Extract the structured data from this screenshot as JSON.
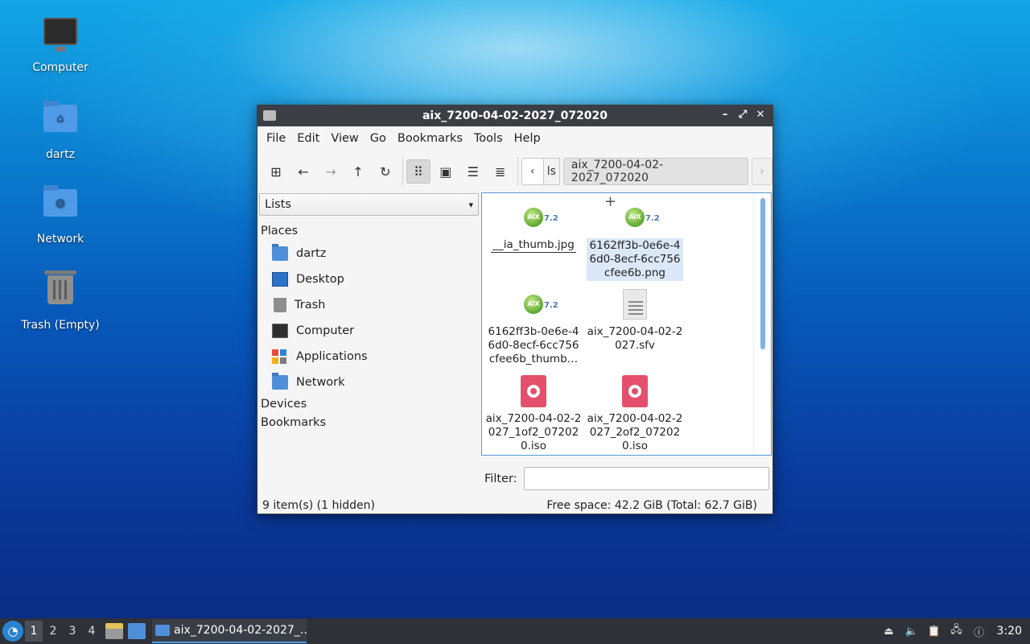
{
  "desktop": {
    "icons": [
      {
        "label": "Computer",
        "icon": "computer-icon"
      },
      {
        "label": "dartz",
        "icon": "home-folder-icon"
      },
      {
        "label": "Network",
        "icon": "network-folder-icon"
      },
      {
        "label": "Trash (Empty)",
        "icon": "trash-icon"
      }
    ]
  },
  "window": {
    "title": "aix_7200-04-02-2027_072020",
    "menu": [
      "File",
      "Edit",
      "View",
      "Go",
      "Bookmarks",
      "Tools",
      "Help"
    ],
    "path": {
      "prev_crumb": "ls",
      "current": "aix_7200-04-02-2027_072020"
    },
    "sidebar": {
      "selector": "Lists",
      "places_heading": "Places",
      "places": [
        {
          "label": "dartz",
          "icon": "home-folder-icon"
        },
        {
          "label": "Desktop",
          "icon": "desktop-icon"
        },
        {
          "label": "Trash",
          "icon": "trash-icon"
        },
        {
          "label": "Computer",
          "icon": "computer-icon"
        },
        {
          "label": "Applications",
          "icon": "applications-icon"
        },
        {
          "label": "Network",
          "icon": "network-folder-icon"
        }
      ],
      "devices_heading": "Devices",
      "bookmarks_heading": "Bookmarks"
    },
    "files": [
      {
        "name": "__ia_thumb.jpg",
        "icon": "aix-image-icon",
        "badge": "AIX",
        "version": "7.2"
      },
      {
        "name": "6162ff3b-0e6e-46d0-8ecf-6cc756cfee6b.png",
        "name_lines": [
          "6162ff3b-0e6e-4",
          "6d0-8ecf-6cc756",
          "cfee6b.png"
        ],
        "icon": "aix-image-icon",
        "badge": "AIX",
        "version": "7.2"
      },
      {
        "name_lines": [
          "6162ff3b-0e6e-4",
          "6d0-8ecf-6cc756",
          "cfee6b_thumb…"
        ],
        "icon": "aix-image-icon",
        "badge": "AIX",
        "version": "7.2"
      },
      {
        "name_lines": [
          "aix_7200-04-02-2",
          "027.sfv"
        ],
        "icon": "text-document-icon"
      },
      {
        "name_lines": [
          "aix_7200-04-02-2",
          "027_1of2_07202",
          "0.iso"
        ],
        "icon": "disc-image-icon"
      },
      {
        "name_lines": [
          "aix_7200-04-02-2",
          "027_2of2_07202",
          "0.iso"
        ],
        "icon": "disc-image-icon"
      }
    ],
    "filter": {
      "label": "Filter:",
      "value": ""
    },
    "status": {
      "items": "9 item(s) (1 hidden)",
      "space": "Free space: 42.2 GiB (Total: 62.7 GiB)"
    }
  },
  "taskbar": {
    "workspaces": [
      "1",
      "2",
      "3",
      "4"
    ],
    "active_workspace": "1",
    "task_label": "aix_7200-04-02-2027_…",
    "clock": "3:20"
  }
}
